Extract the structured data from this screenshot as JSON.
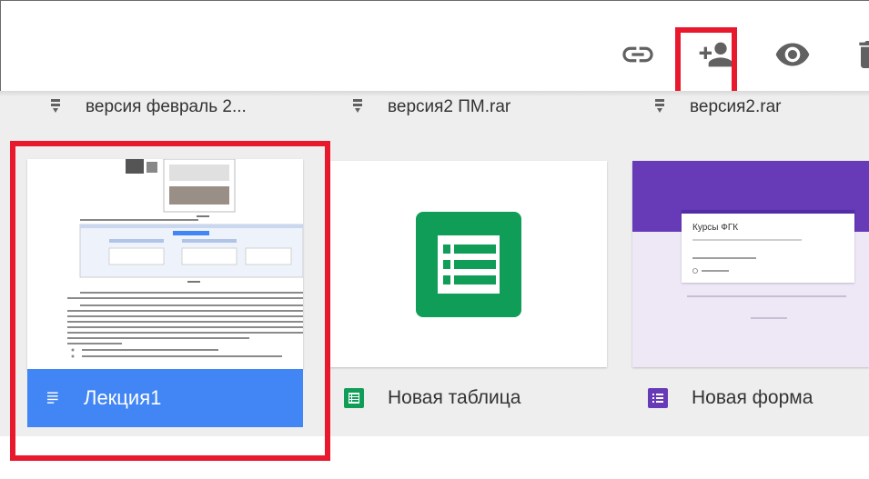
{
  "toolbar": {
    "icons": [
      "link-icon",
      "add-person-icon",
      "eye-icon",
      "trash-icon"
    ],
    "icon_color": "#616161"
  },
  "files": [
    {
      "name": "версия февраль 2...",
      "icon": "archive-icon"
    },
    {
      "name": "версия2 ПМ.rar",
      "icon": "archive-icon"
    },
    {
      "name": "версия2.rar",
      "icon": "archive-icon"
    }
  ],
  "cards": [
    {
      "title": "Лекция1",
      "icon": "docs-icon",
      "color": "#4285f4",
      "selected": true
    },
    {
      "title": "Новая таблица",
      "icon": "sheets-icon",
      "color": "#0f9d58"
    },
    {
      "title": "Новая форма",
      "icon": "forms-icon",
      "color": "#673ab7"
    }
  ],
  "form_preview": {
    "title": "Курсы ФГК"
  },
  "highlight_color": "#e8192c"
}
